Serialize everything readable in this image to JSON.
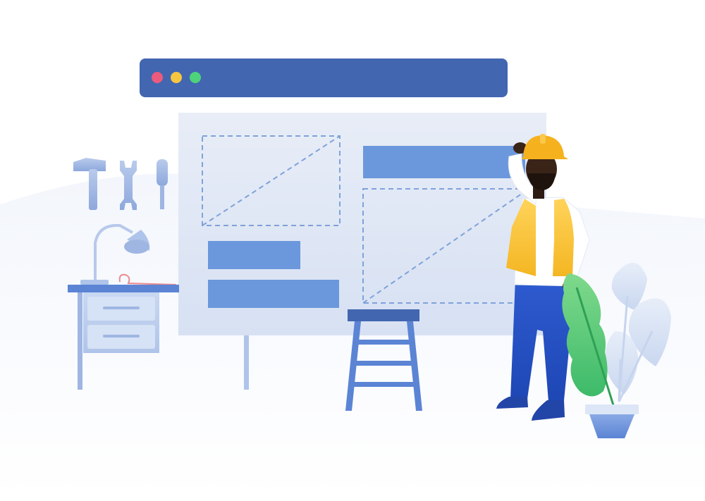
{
  "illustration": {
    "browser_window": {
      "controls": [
        {
          "name": "close",
          "color": "#EC5A7D"
        },
        {
          "name": "minimize",
          "color": "#F7C641"
        },
        {
          "name": "maximize",
          "color": "#4ED27C"
        }
      ],
      "titlebar_color": "#4266B0"
    },
    "colors": {
      "panel_fill": "#E6EBF6",
      "block_fill": "#6B97DC",
      "dash_stroke": "#7FA2DA",
      "helmet": "#F5B21E",
      "vest": "#FDC93C",
      "pants": "#2B56C8",
      "plant_green": "#59C96E",
      "plant_light": "#DCE6F6",
      "desk": "#5B84D4",
      "tools": "#A8BDE6",
      "background_ground": "#F6F8FC"
    }
  }
}
